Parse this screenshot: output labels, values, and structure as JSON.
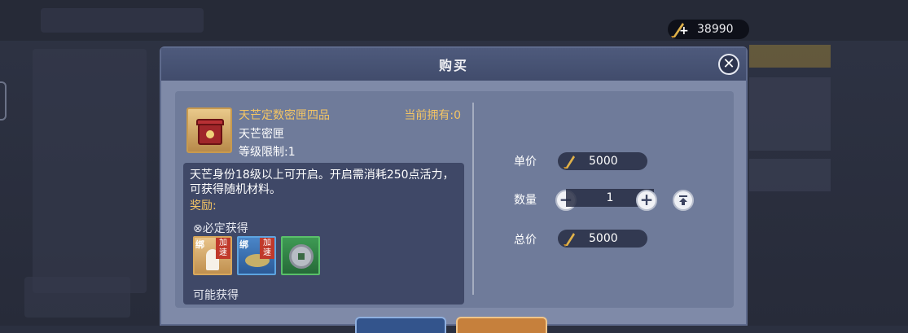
{
  "currency": {
    "icon": "quill-currency-icon",
    "value": "38990"
  },
  "dialog": {
    "title": "购买",
    "close_icon": "close-icon",
    "item": {
      "name": "天芒定数密匣四品",
      "subtitle": "天芒密匣",
      "level_limit": "等级限制:1",
      "owned": "当前拥有:0",
      "description": "天芒身份18级以上可开启。开启需消耗250点活力，可获得随机材料。",
      "reward_label": "奖励:",
      "guaranteed_label": "必定获得",
      "rewards": [
        {
          "icon": "figure-icon",
          "bind": "绑",
          "speed": "加速"
        },
        {
          "icon": "creature-icon",
          "bind": "绑",
          "speed": "加速"
        },
        {
          "icon": "coin-icon"
        }
      ],
      "next_section_cut": "可能获得"
    },
    "purchase": {
      "unit_price_label": "单价",
      "unit_price": "5000",
      "quantity_label": "数量",
      "quantity": "1",
      "total_label": "总价",
      "total": "5000"
    }
  }
}
